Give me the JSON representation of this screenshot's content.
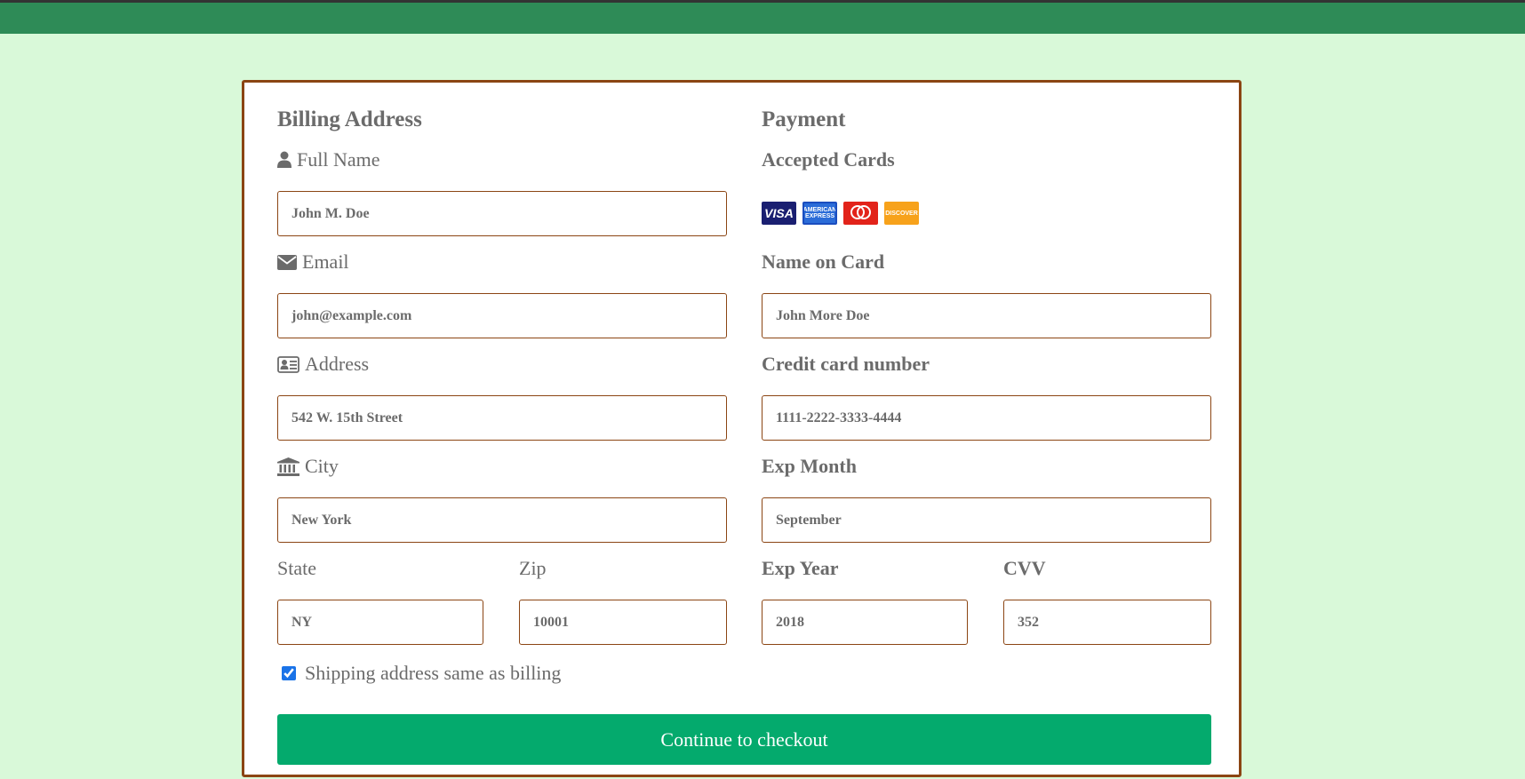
{
  "billing": {
    "heading": "Billing Address",
    "full_name_label": "Full Name",
    "full_name_value": "John M. Doe",
    "email_label": "Email",
    "email_value": "john@example.com",
    "address_label": "Address",
    "address_value": "542 W. 15th Street",
    "city_label": "City",
    "city_value": "New York",
    "state_label": "State",
    "state_value": "NY",
    "zip_label": "Zip",
    "zip_value": "10001"
  },
  "payment": {
    "heading": "Payment",
    "accepted_cards_label": "Accepted Cards",
    "card_brands": [
      "visa-icon",
      "amex-icon",
      "mastercard-icon",
      "discover-icon"
    ],
    "name_on_card_label": "Name on Card",
    "name_on_card_value": "John More Doe",
    "cc_number_label": "Credit card number",
    "cc_number_value": "1111-2222-3333-4444",
    "exp_month_label": "Exp Month",
    "exp_month_value": "September",
    "exp_year_label": "Exp Year",
    "exp_year_value": "2018",
    "cvv_label": "CVV",
    "cvv_value": "352"
  },
  "shipping_same_label": "Shipping address same as billing",
  "shipping_same_checked": true,
  "checkout_label": "Continue to checkout",
  "colors": {
    "background": "#d9f9d9",
    "topbar": "#2e8b57",
    "border": "#8b4513",
    "button": "#04aa6d"
  }
}
